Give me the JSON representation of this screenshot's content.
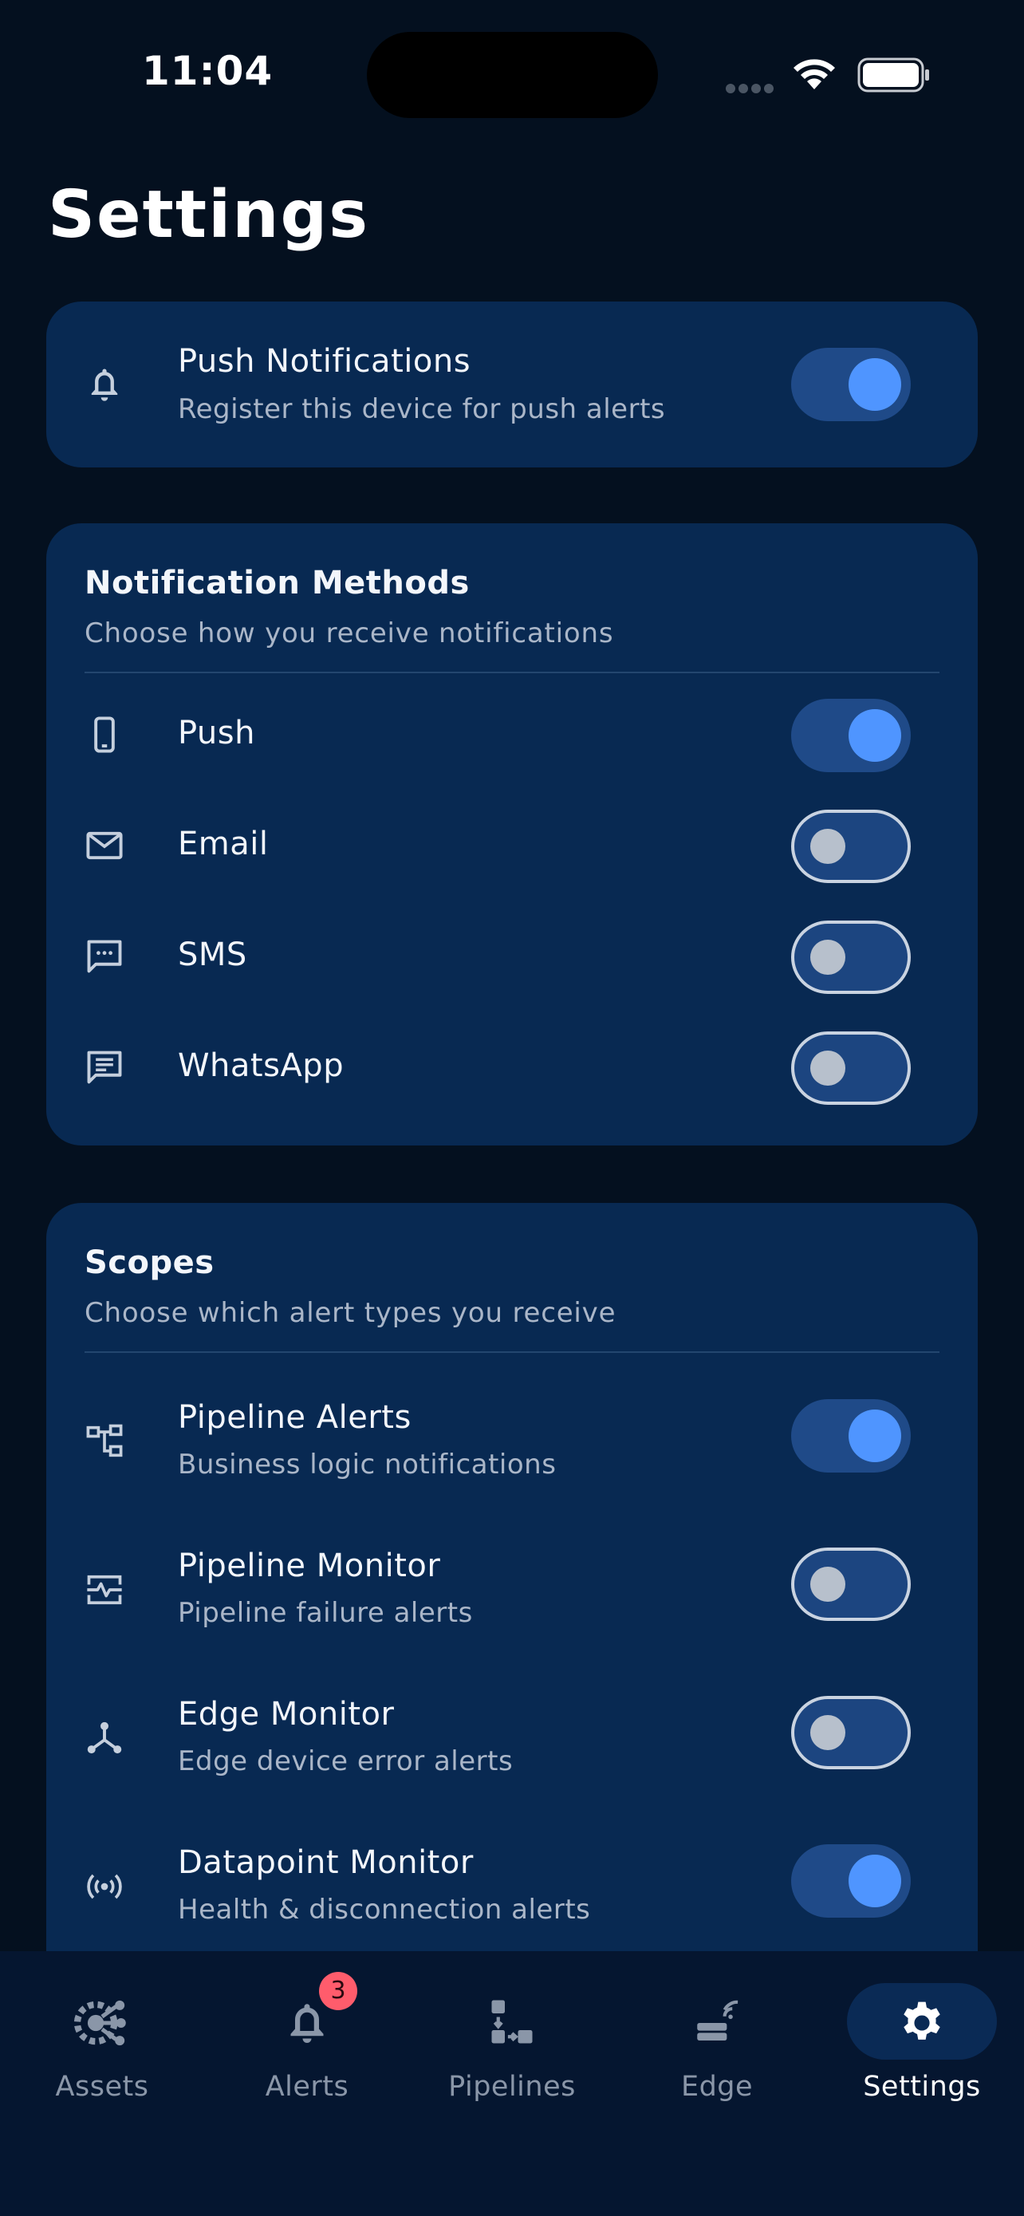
{
  "status_bar": {
    "time": "11:04"
  },
  "page": {
    "title": "Settings"
  },
  "push_card": {
    "title": "Push Notifications",
    "subtitle": "Register this device for push alerts",
    "enabled": true
  },
  "methods": {
    "title": "Notification Methods",
    "subtitle": "Choose how you receive notifications",
    "items": [
      {
        "label": "Push",
        "icon": "phone-icon",
        "enabled": true
      },
      {
        "label": "Email",
        "icon": "mail-icon",
        "enabled": false
      },
      {
        "label": "SMS",
        "icon": "sms-icon",
        "enabled": false
      },
      {
        "label": "WhatsApp",
        "icon": "message-icon",
        "enabled": false
      }
    ]
  },
  "scopes": {
    "title": "Scopes",
    "subtitle": "Choose which alert types you receive",
    "items": [
      {
        "label": "Pipeline Alerts",
        "description": "Business logic notifications",
        "icon": "flow-icon",
        "enabled": true
      },
      {
        "label": "Pipeline Monitor",
        "description": "Pipeline failure alerts",
        "icon": "monitor-icon",
        "enabled": false
      },
      {
        "label": "Edge Monitor",
        "description": "Edge device error alerts",
        "icon": "hub-icon",
        "enabled": false
      },
      {
        "label": "Datapoint Monitor",
        "description": "Health & disconnection alerts",
        "icon": "signal-icon",
        "enabled": true
      }
    ]
  },
  "tab_bar": {
    "tabs": [
      {
        "label": "Assets",
        "icon": "assets-gear-icon",
        "active": false
      },
      {
        "label": "Alerts",
        "icon": "bell-icon",
        "badge": "3",
        "active": false
      },
      {
        "label": "Pipelines",
        "icon": "pipelines-icon",
        "active": false
      },
      {
        "label": "Edge",
        "icon": "edge-device-icon",
        "active": false
      },
      {
        "label": "Settings",
        "icon": "settings-gear-icon",
        "active": true
      }
    ]
  },
  "colors": {
    "background": "#04101f",
    "card": "#082952",
    "accent": "#4f95ff",
    "badge": "#ff5c6c"
  }
}
